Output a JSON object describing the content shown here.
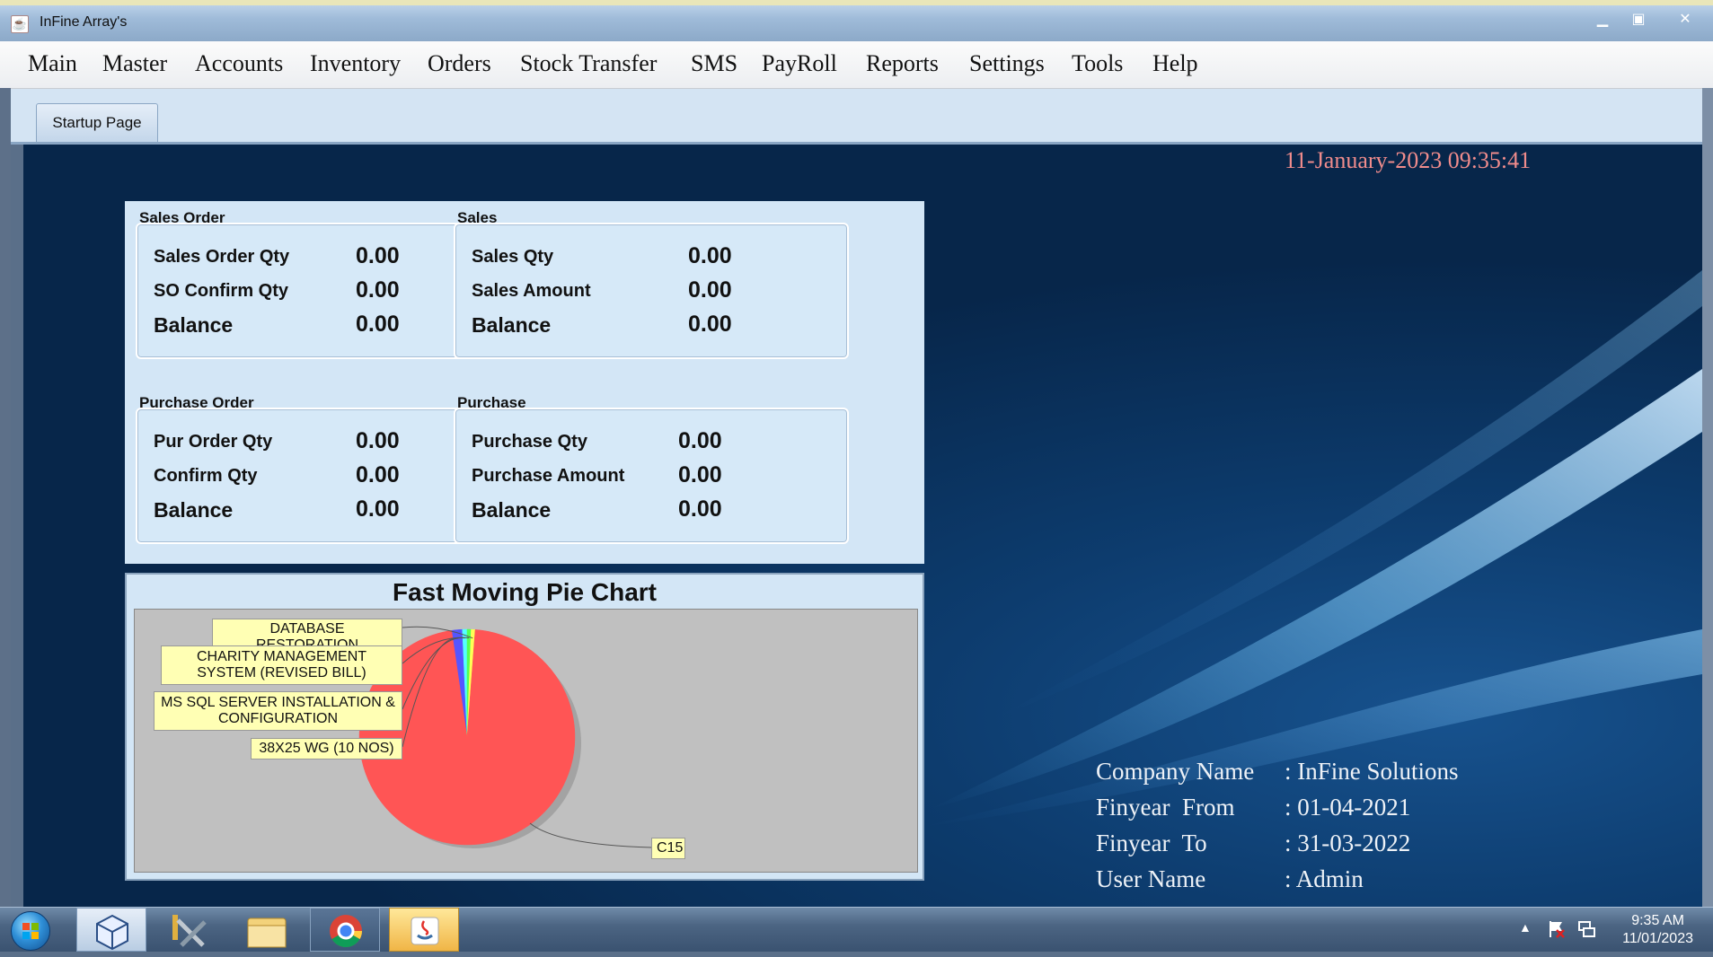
{
  "window": {
    "title": "InFine Array's"
  },
  "menu": [
    {
      "label": "Main"
    },
    {
      "label": "Master"
    },
    {
      "label": "Accounts"
    },
    {
      "label": "Inventory"
    },
    {
      "label": "Orders"
    },
    {
      "label": "Stock Transfer"
    },
    {
      "label": "SMS"
    },
    {
      "label": "PayRoll"
    },
    {
      "label": "Reports"
    },
    {
      "label": "Settings"
    },
    {
      "label": "Tools"
    },
    {
      "label": "Help"
    }
  ],
  "tabs": [
    {
      "label": "Startup Page"
    }
  ],
  "datetime": "11-January-2023 09:35:41",
  "sales_order": {
    "title": "Sales Order",
    "rows": [
      {
        "label": "Sales Order Qty",
        "value": "0.00"
      },
      {
        "label": "SO Confirm Qty",
        "value": "0.00"
      },
      {
        "label": "Balance",
        "value": "0.00"
      }
    ]
  },
  "sales": {
    "title": "Sales",
    "rows": [
      {
        "label": "Sales Qty",
        "value": "0.00"
      },
      {
        "label": "Sales Amount",
        "value": "0.00"
      },
      {
        "label": "Balance",
        "value": "0.00"
      }
    ]
  },
  "purchase_order": {
    "title": "Purchase Order",
    "rows": [
      {
        "label": "Pur Order Qty",
        "value": "0.00"
      },
      {
        "label": "Confirm Qty",
        "value": "0.00"
      },
      {
        "label": "Balance",
        "value": "0.00"
      }
    ]
  },
  "purchase": {
    "title": "Purchase",
    "rows": [
      {
        "label": "Purchase Qty",
        "value": "0.00"
      },
      {
        "label": "Purchase Amount",
        "value": "0.00"
      },
      {
        "label": "Balance",
        "value": "0.00"
      }
    ]
  },
  "chart_data": {
    "type": "pie",
    "title": "Fast Moving Pie Chart",
    "slices": [
      {
        "label": "C15",
        "value": 96.5,
        "color": "#ff5555"
      },
      {
        "label": "DATABASE RESTORATION",
        "value": 0.6,
        "color": "#ffff55"
      },
      {
        "label": "CHARITY MANAGEMENT SYSTEM (REVISED BILL)",
        "value": 0.6,
        "color": "#55ff55"
      },
      {
        "label": "MS SQL SERVER INSTALLATION & CONFIGURATION",
        "value": 0.7,
        "color": "#55ffff"
      },
      {
        "label": "38X25 WG (10 NOS)",
        "value": 1.6,
        "color": "#5555ff"
      }
    ]
  },
  "company": {
    "rows": [
      {
        "label": "Company Name",
        "value": ": InFine Solutions"
      },
      {
        "label": "Finyear  From",
        "value": ": 01-04-2021"
      },
      {
        "label": "Finyear  To",
        "value": ": 31-03-2022"
      },
      {
        "label": "User Name",
        "value": ": Admin"
      }
    ]
  },
  "taskbar": {
    "time": "9:35 AM",
    "date": "11/01/2023"
  }
}
